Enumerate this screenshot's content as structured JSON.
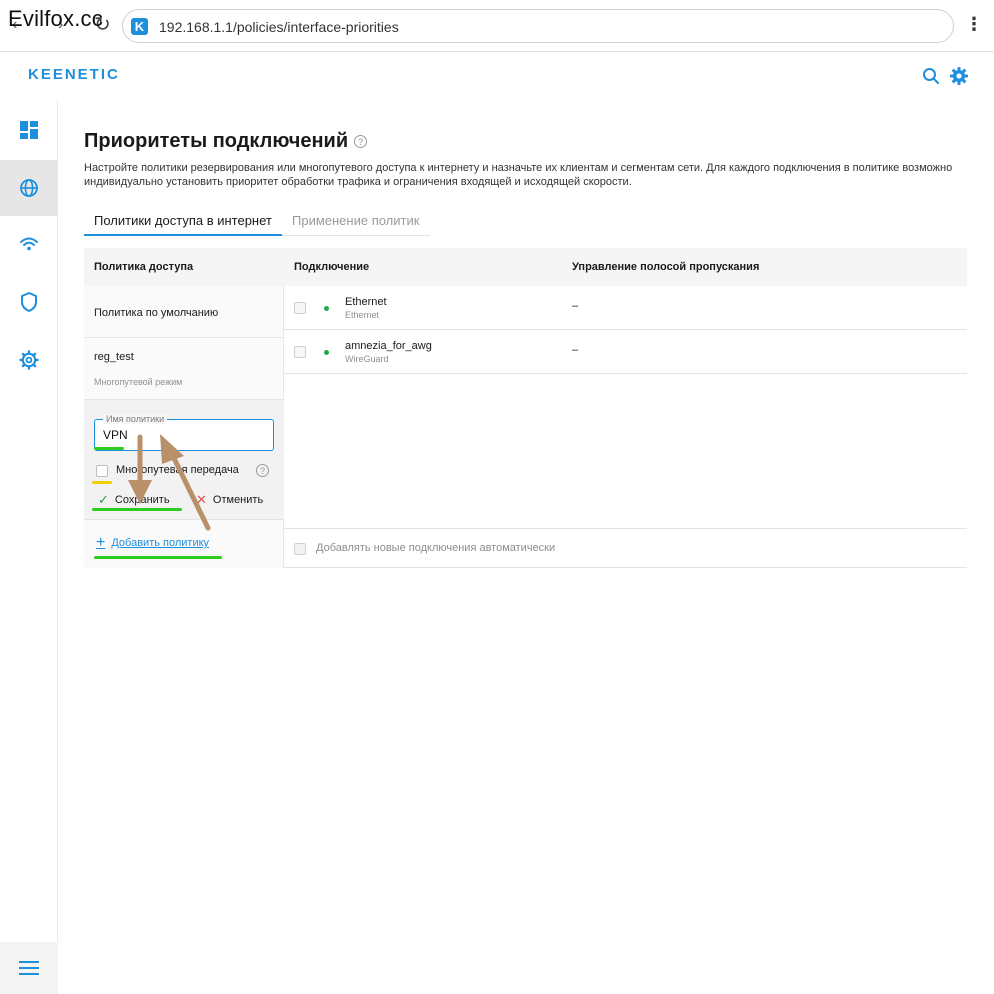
{
  "watermark": "Evilfox.cc",
  "browser": {
    "url": "192.168.1.1/policies/interface-priorities",
    "site_icon_letter": "K"
  },
  "header": {
    "logo": "KEENETIC"
  },
  "sidebar": {
    "items": [
      {
        "name": "dashboard",
        "icon": "dashboard-icon"
      },
      {
        "name": "internet",
        "icon": "globe-icon",
        "active": true
      },
      {
        "name": "wifi",
        "icon": "wifi-icon"
      },
      {
        "name": "security",
        "icon": "shield-icon"
      },
      {
        "name": "settings",
        "icon": "gear-icon"
      }
    ],
    "bottom_icon": "hamburger-menu-icon"
  },
  "page": {
    "title": "Приоритеты подключений",
    "help": "?",
    "description": "Настройте политики резервирования или многопутевого доступа к интернету и назначьте их клиентам и сегментам сети. Для каждого подключения в политике возможно индивидуально установить приоритет обработки трафика и ограничения входящей и исходящей скорости."
  },
  "tabs": [
    {
      "label": "Политики доступа в интернет",
      "active": true
    },
    {
      "label": "Применение политик",
      "active": false
    }
  ],
  "table": {
    "headers": {
      "policy": "Политика доступа",
      "connection": "Подключение",
      "bandwidth": "Управление полосой пропускания"
    },
    "policies": [
      {
        "name": "Политика по умолчанию",
        "sub": ""
      },
      {
        "name": "reg_test",
        "sub": "Многопутевой режим"
      }
    ],
    "editor": {
      "field_label": "Имя политики",
      "field_value": "VPN",
      "multipath_label": "Многопутевая передача",
      "multipath_checked": false,
      "help": "?",
      "save_label": "Сохранить",
      "cancel_label": "Отменить"
    },
    "add_policy_label": "Добавить политику",
    "connections": [
      {
        "name": "Ethernet",
        "type": "Ethernet",
        "bandwidth": "–",
        "status_color": "#1fa84a"
      },
      {
        "name": "amnezia_for_awg",
        "type": "WireGuard",
        "bandwidth": "–",
        "status_color": "#1fa84a"
      }
    ],
    "auto_add_label": "Добавлять новые подключения автоматически"
  },
  "colors": {
    "accent": "#1d8fdc",
    "status_online": "#1fa84a",
    "annotation_underline": "#2ecc1e",
    "annotation_yellow": "#f0d000",
    "annotation_arrow": "#b8906a"
  }
}
